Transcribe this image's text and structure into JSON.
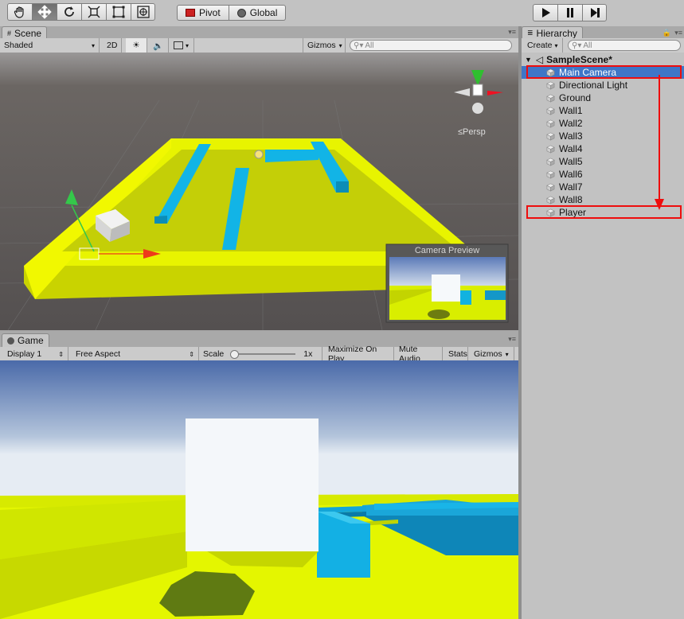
{
  "toolbar": {
    "tools": [
      "hand-tool",
      "move-tool",
      "rotate-tool",
      "scale-tool",
      "rect-tool",
      "transform-tool"
    ],
    "pivot_label": "Pivot",
    "global_label": "Global",
    "play_controls": [
      "play",
      "pause",
      "step"
    ]
  },
  "scene": {
    "tab_label": "Scene",
    "shading_mode": "Shaded",
    "mode_2d_label": "2D",
    "gizmos_label": "Gizmos",
    "search_placeholder": "All",
    "persp_label": "Persp",
    "camera_preview_label": "Camera Preview"
  },
  "game": {
    "tab_label": "Game",
    "display": "Display 1",
    "aspect": "Free Aspect",
    "scale_label": "Scale",
    "scale_value": "1x",
    "maximize_label": "Maximize On Play",
    "mute_label": "Mute Audio",
    "stats_label": "Stats",
    "gizmos_label": "Gizmos"
  },
  "hierarchy": {
    "tab_label": "Hierarchy",
    "create_label": "Create",
    "search_placeholder": "All",
    "scene_name": "SampleScene*",
    "items": [
      {
        "label": "Main Camera",
        "selected": true
      },
      {
        "label": "Directional Light"
      },
      {
        "label": "Ground"
      },
      {
        "label": "Wall1"
      },
      {
        "label": "Wall2"
      },
      {
        "label": "Wall3"
      },
      {
        "label": "Wall4"
      },
      {
        "label": "Wall5"
      },
      {
        "label": "Wall6"
      },
      {
        "label": "Wall7"
      },
      {
        "label": "Wall8"
      },
      {
        "label": "Player"
      }
    ]
  },
  "colors": {
    "ground": "#e8f400",
    "wall": "#11b8e8",
    "annotation": "#ee0d0d",
    "selection": "#3f76c7"
  }
}
